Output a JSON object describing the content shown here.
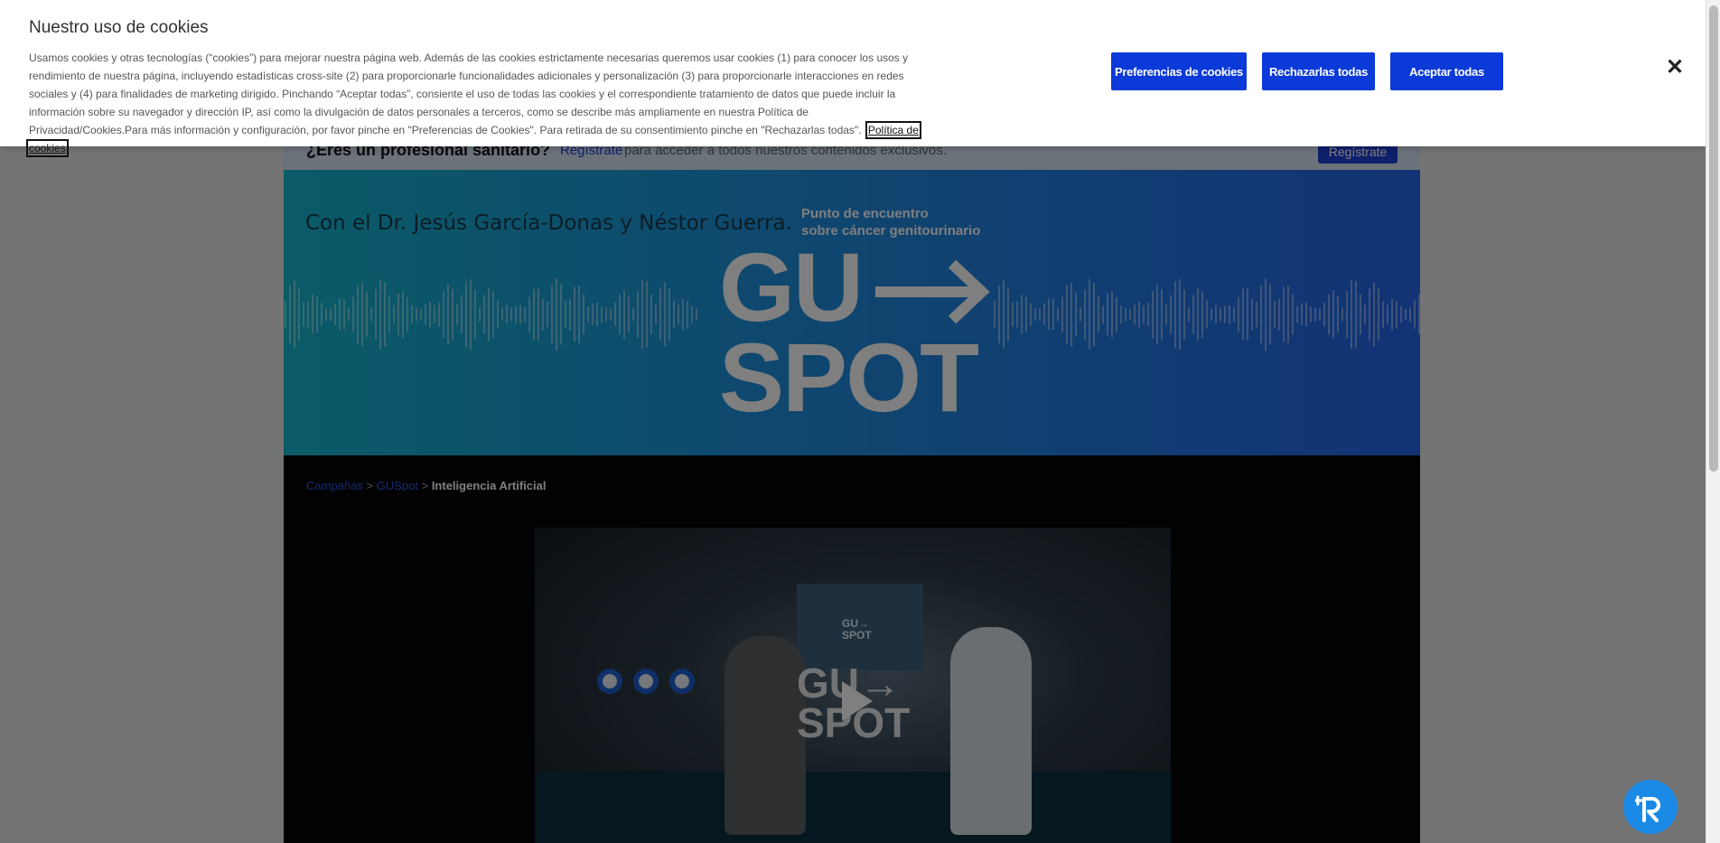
{
  "registration_bar": {
    "title": "¿Eres un profesional sanitario?",
    "link": "Regístrate",
    "text": "para acceder a todos nuestros contenidos exclusivos.",
    "button": "Regístrate"
  },
  "hero": {
    "subtitle": "Con el Dr. Jesús García-Donas y Néstor Guerra.",
    "kicker_line1": "Punto de encuentro",
    "kicker_line2": "sobre cáncer genitourinario",
    "logo_top": "GU",
    "logo_bottom": "SPOT"
  },
  "breadcrumb": {
    "item1": "Campañas",
    "sep": ">",
    "item2": "GUSpot",
    "current": "Inteligencia Artificial"
  },
  "video": {
    "screen_text_line1": "GU→",
    "screen_text_line2": "SPOT",
    "overlay_logo_line1": "GU→",
    "overlay_logo_line2": "SPOT"
  },
  "cookie_banner": {
    "title": "Nuestro uso de cookies",
    "text": "Usamos cookies y otras tecnologías (“cookies”) para mejorar nuestra página web. Además de las cookies estrictamente necesarias queremos usar cookies (1) para conocer los usos y rendimiento de nuestra página, incluyendo estadísticas cross-site (2) para proporcionarle funcionalidades adicionales y personalización (3) para proporcionarle interacciones en redes sociales y (4) para finalidades de marketing dirigido. Pinchando “Aceptar todas”, consiente el uso de todas las cookies y el correspondiente tratamiento de datos que puede incluir la información sobre su navegador y dirección IP, así como la divulgación de datos personales a terceros, como se describe más ampliamente en nuestra Política de Privacidad/Cookies.Para más información y configuración, por favor pinche en \"Preferencias de Cookies\". Para retirada de su consentimiento pinche en \"Rechazarlas todas\".",
    "policy_link": "Política de cookies",
    "btn_preferences": "Preferencias de cookies",
    "btn_reject": "Rechazarlas todas",
    "btn_accept": "Aceptar todas",
    "close_glyph": "✕"
  },
  "colors": {
    "primary_button": "#0b3ad9",
    "hero_start": "#14b6cf",
    "hero_end": "#2566ea",
    "fab": "#1b8ae6"
  },
  "icons": [
    "close-icon",
    "play-icon",
    "assistant-widget-icon",
    "arrow-icon"
  ]
}
